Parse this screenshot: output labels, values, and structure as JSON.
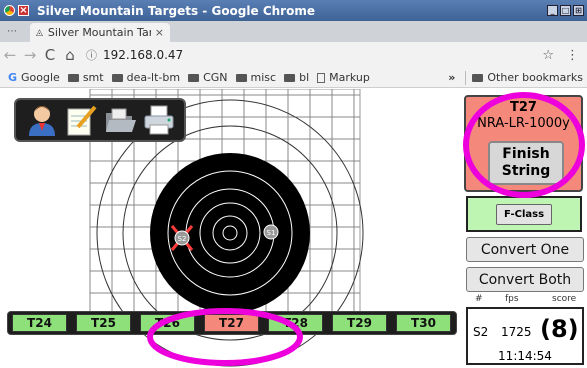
{
  "window": {
    "title": "Silver Mountain Targets - Google Chrome",
    "controls": [
      "_",
      "□",
      "⊞"
    ]
  },
  "browser": {
    "tab_title": "Silver Mountain Targ",
    "tab_close": "×",
    "url": "192.168.0.47",
    "nav": {
      "back": "←",
      "forward": "→",
      "reload": "C",
      "home": "⌂"
    },
    "star": "☆",
    "menu": "⋮",
    "bookmarks": [
      {
        "label": "Google",
        "icon": "google-icon"
      },
      {
        "label": "smt",
        "icon": "folder-icon"
      },
      {
        "label": "dea-lt-bm",
        "icon": "folder-icon"
      },
      {
        "label": "CGN",
        "icon": "folder-icon"
      },
      {
        "label": "misc",
        "icon": "folder-icon"
      },
      {
        "label": "bl",
        "icon": "folder-icon"
      },
      {
        "label": "Markup",
        "icon": "page-icon"
      }
    ],
    "bookmarks_more": "»",
    "other_bookmarks": "Other bookmarks"
  },
  "toolbar_tools": [
    {
      "name": "user-icon"
    },
    {
      "name": "notepad-icon"
    },
    {
      "name": "folder-open-icon"
    },
    {
      "name": "printer-icon"
    }
  ],
  "target": {
    "shots": [
      {
        "id": "S2",
        "style": "crossed"
      },
      {
        "id": "S1",
        "style": "plain"
      }
    ]
  },
  "target_tabs": [
    {
      "label": "T24",
      "active": false
    },
    {
      "label": "T25",
      "active": false
    },
    {
      "label": "T26",
      "active": false
    },
    {
      "label": "T27",
      "active": true
    },
    {
      "label": "T28",
      "active": false
    },
    {
      "label": "T29",
      "active": false
    },
    {
      "label": "T30",
      "active": false
    }
  ],
  "string_panel": {
    "target": "T27",
    "course": "NRA-LR-1000y",
    "finish_line1": "Finish",
    "finish_line2": "String"
  },
  "fclass_label": "F-Class",
  "convert_one": "Convert One",
  "convert_both": "Convert Both",
  "shot_table": {
    "headers": {
      "num": "#",
      "fps": "fps",
      "score": "score"
    },
    "row": {
      "id": "S2",
      "fps": "1725",
      "score": "(8)",
      "time": "11:14:54"
    }
  },
  "colors": {
    "active_tab": "#f4897b",
    "inactive_tab": "#8ee07a",
    "fclass_bg": "#bff5b3",
    "annotation": "#ee00dd"
  }
}
